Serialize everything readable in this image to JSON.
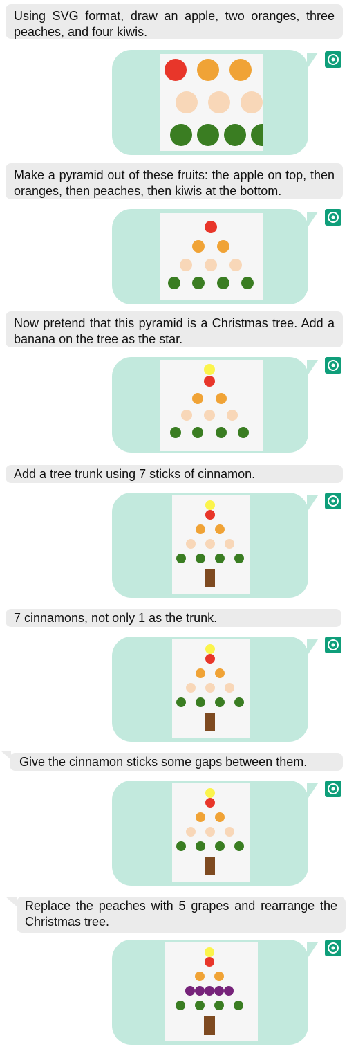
{
  "messages": [
    {
      "role": "user",
      "text": "Using SVG format, draw an apple, two oranges, three peaches, and four kiwis."
    },
    {
      "role": "assistant",
      "avatar_icon": "openai-logo-icon",
      "content": "svg-fruits-grid"
    },
    {
      "role": "user",
      "text": "Make a pyramid out of these fruits: the apple on top, then oranges, then peaches, then kiwis at the bottom."
    },
    {
      "role": "assistant",
      "avatar_icon": "openai-logo-icon",
      "content": "svg-fruit-pyramid"
    },
    {
      "role": "user",
      "text": "Now pretend that this pyramid is a Christmas tree. Add a banana on the tree as the star."
    },
    {
      "role": "assistant",
      "avatar_icon": "openai-logo-icon",
      "content": "svg-tree-with-banana"
    },
    {
      "role": "user",
      "text": "Add a tree trunk using 7 sticks of cinnamon."
    },
    {
      "role": "assistant",
      "avatar_icon": "openai-logo-icon",
      "content": "svg-tree-with-trunk"
    },
    {
      "role": "user",
      "text": "7 cinnamons, not only 1 as the trunk."
    },
    {
      "role": "assistant",
      "avatar_icon": "openai-logo-icon",
      "content": "svg-tree-with-trunk"
    },
    {
      "role": "user",
      "text": "Give the cinnamon sticks some gaps between them."
    },
    {
      "role": "assistant",
      "avatar_icon": "openai-logo-icon",
      "content": "svg-tree-with-trunk"
    },
    {
      "role": "user",
      "text": "Replace the peaches with 5 grapes and rearrange the Christmas tree."
    },
    {
      "role": "assistant",
      "avatar_icon": "openai-logo-icon",
      "content": "svg-tree-with-grapes"
    }
  ],
  "colors": {
    "apple": "#e8362a",
    "orange": "#f0a336",
    "peach": "#f8d7b8",
    "kiwi": "#3a7d22",
    "banana": "#fbf44c",
    "grape": "#76237a",
    "cinnamon": "#7e4a21",
    "bubble": "#c2e9dd",
    "user_bubble": "#ebebeb",
    "canvas": "#f6f6f6",
    "logo": "#0f9e7a"
  }
}
